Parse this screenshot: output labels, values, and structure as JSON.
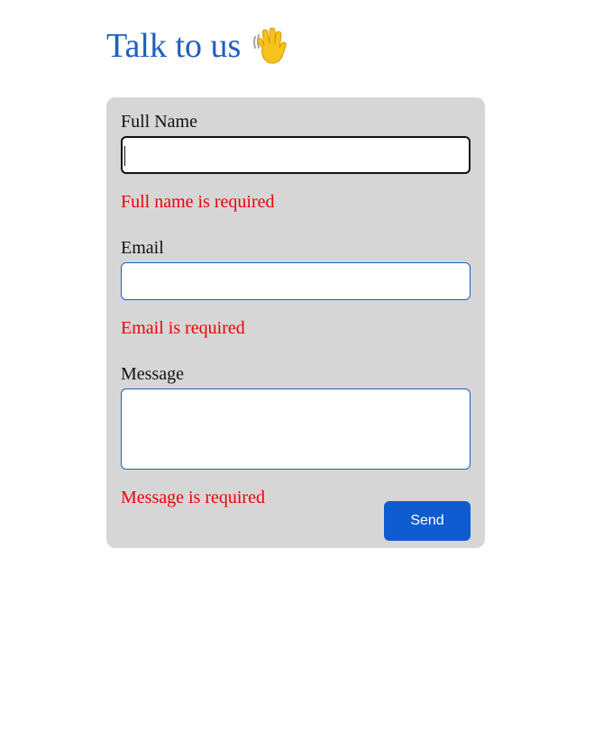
{
  "header": {
    "title": "Talk to us",
    "icon": "waving-hand-icon",
    "title_color": "#1f5fbf"
  },
  "form": {
    "card_color": "#d6d6d6",
    "full_name": {
      "label": "Full Name",
      "value": "",
      "error": "Full name is required"
    },
    "email": {
      "label": "Email",
      "value": "",
      "error": "Email is required"
    },
    "message": {
      "label": "Message",
      "value": "",
      "error": "Message is required"
    },
    "send_label": "Send",
    "button_color": "#0f5bd0",
    "error_color": "#ee0000"
  }
}
